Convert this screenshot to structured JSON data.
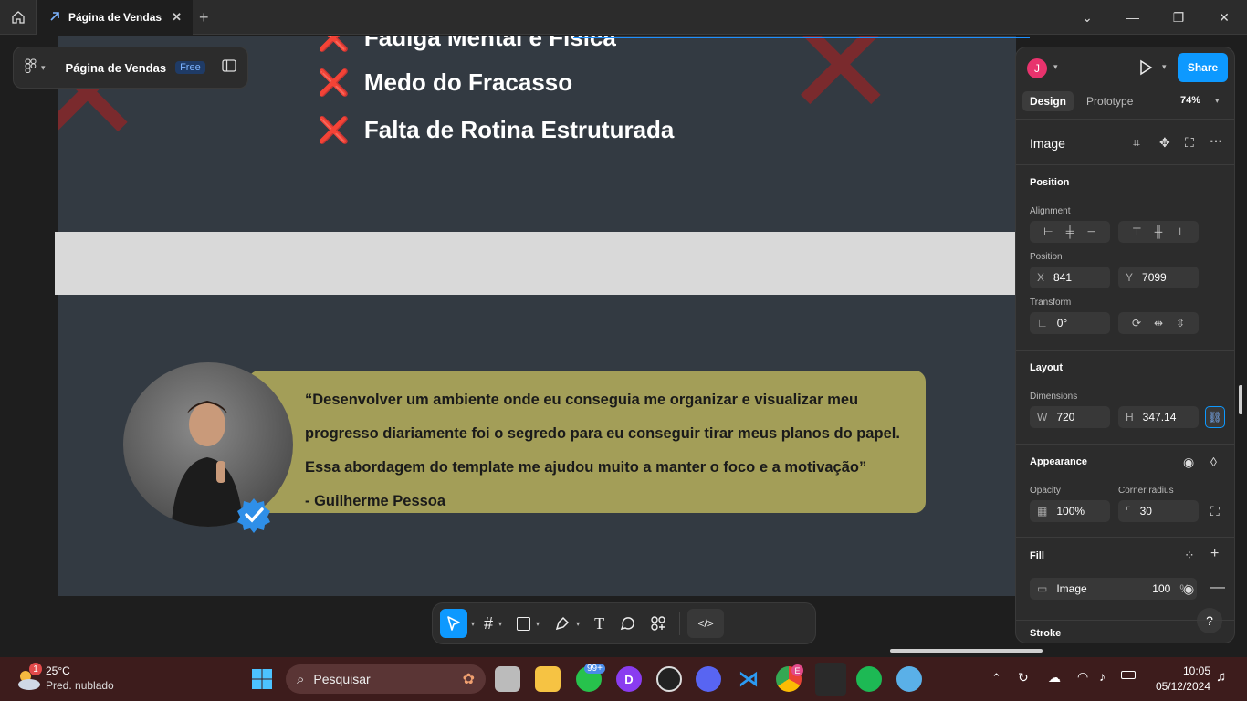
{
  "titlebar": {
    "tab_title": "Página de Vendas",
    "new_tab": "+",
    "minimize": "—",
    "maximize": "❐",
    "close": "✕"
  },
  "canvas": {
    "pains": [
      "Fadiga Mental e Física",
      "Medo do Fracasso",
      "Falta de Rotina Estruturada"
    ],
    "pain_mark": "❌",
    "testimonial": {
      "quote_lines": [
        "“Desenvolver um ambiente onde eu conseguia me organizar e visualizar meu",
        "progresso diariamente foi o segredo para eu conseguir tirar meus planos do papel.",
        "Essa abordagem do template me ajudou muito a manter o foco e a motivação”",
        "- Guilherme Pessoa"
      ]
    }
  },
  "file_panel": {
    "name": "Página de Vendas",
    "plan": "Free"
  },
  "toolbar": {
    "text_tool": "T",
    "dev_mode": "</>"
  },
  "props": {
    "avatar_initial": "J",
    "share": "Share",
    "tabs": [
      "Design",
      "Prototype"
    ],
    "zoom": "74%",
    "layer_type": "Image",
    "position_title": "Position",
    "alignment_label": "Alignment",
    "position_label": "Position",
    "x_key": "X",
    "x": "841",
    "y_key": "Y",
    "y": "7099",
    "transform_label": "Transform",
    "rotation": "0°",
    "layout_title": "Layout",
    "dimensions_label": "Dimensions",
    "w_key": "W",
    "w": "720",
    "h_key": "H",
    "h": "347.14",
    "appearance_title": "Appearance",
    "opacity_label": "Opacity",
    "opacity": "100%",
    "radius_label": "Corner radius",
    "radius": "30",
    "fill_title": "Fill",
    "fill_type": "Image",
    "fill_opacity": "100",
    "fill_unit": "%",
    "stroke_title": "Stroke",
    "help": "?"
  },
  "taskbar": {
    "weather_temp": "25°C",
    "weather_desc": "Pred. nublado",
    "weather_badge": "1",
    "search_placeholder": "Pesquisar",
    "whatsapp_badge": "99+",
    "chrome_badge": "E",
    "time": "10:05",
    "date": "05/12/2024"
  },
  "colors": {
    "accent": "#0d99ff",
    "quote_bg": "#a39e58",
    "frame_bg": "#333a42",
    "taskbar_bg": "#3d1c1c"
  }
}
